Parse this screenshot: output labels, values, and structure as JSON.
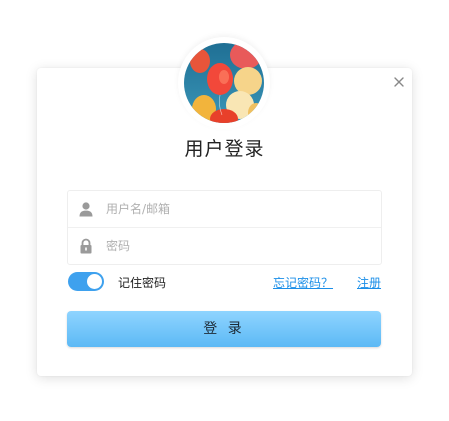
{
  "dialog": {
    "title": "用户登录",
    "close_icon": "close-icon"
  },
  "avatar": {
    "icon": "balloons-photo",
    "colors": [
      "#2c7fa3",
      "#f04a2a",
      "#f2b43c",
      "#f7e3a8"
    ]
  },
  "form": {
    "username": {
      "placeholder": "用户名/邮箱",
      "value": "",
      "icon": "user-icon"
    },
    "password": {
      "placeholder": "密码",
      "value": "",
      "icon": "lock-icon"
    }
  },
  "options": {
    "remember_label": "记住密码",
    "remember_checked": true,
    "forgot_label": "忘记密码？",
    "register_label": "注册"
  },
  "submit": {
    "label": "登 录"
  },
  "colors": {
    "accent": "#3ea1ee",
    "link": "#1a8ee8",
    "button_top": "#8fd4ff",
    "button_bottom": "#5cb9f5"
  }
}
